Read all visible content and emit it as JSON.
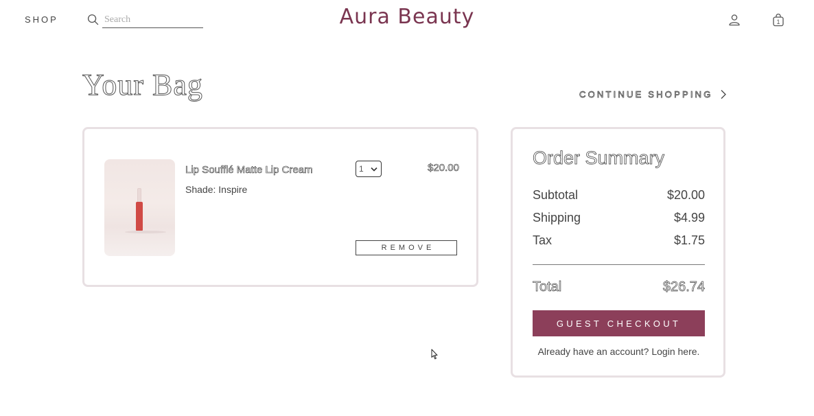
{
  "header": {
    "shop_label": "SHOP",
    "search_placeholder": "Search",
    "brand": "Aura Beauty",
    "bag_count": "1"
  },
  "page": {
    "title": "Your Bag",
    "continue_label": "CONTINUE SHOPPING"
  },
  "cart": {
    "items": [
      {
        "name": "Lip Soufflé Matte Lip Cream",
        "shade": "Shade: Inspire",
        "quantity": "1",
        "price": "$20.00",
        "remove_label": "REMOVE"
      }
    ]
  },
  "summary": {
    "title": "Order Summary",
    "subtotal_label": "Subtotal",
    "subtotal_value": "$20.00",
    "shipping_label": "Shipping",
    "shipping_value": "$4.99",
    "tax_label": "Tax",
    "tax_value": "$1.75",
    "total_label": "Total",
    "total_value": "$26.74",
    "checkout_label": "GUEST CHECKOUT",
    "login_text": "Already have an account? Login here."
  },
  "colors": {
    "brand": "#7a3550",
    "checkout_button": "#8c3f5a",
    "card_border": "#e8e0e3",
    "product_red": "#d04a45"
  },
  "icons": [
    "search-icon",
    "user-icon",
    "bag-icon",
    "chevron-right-icon",
    "chevron-down-icon"
  ]
}
